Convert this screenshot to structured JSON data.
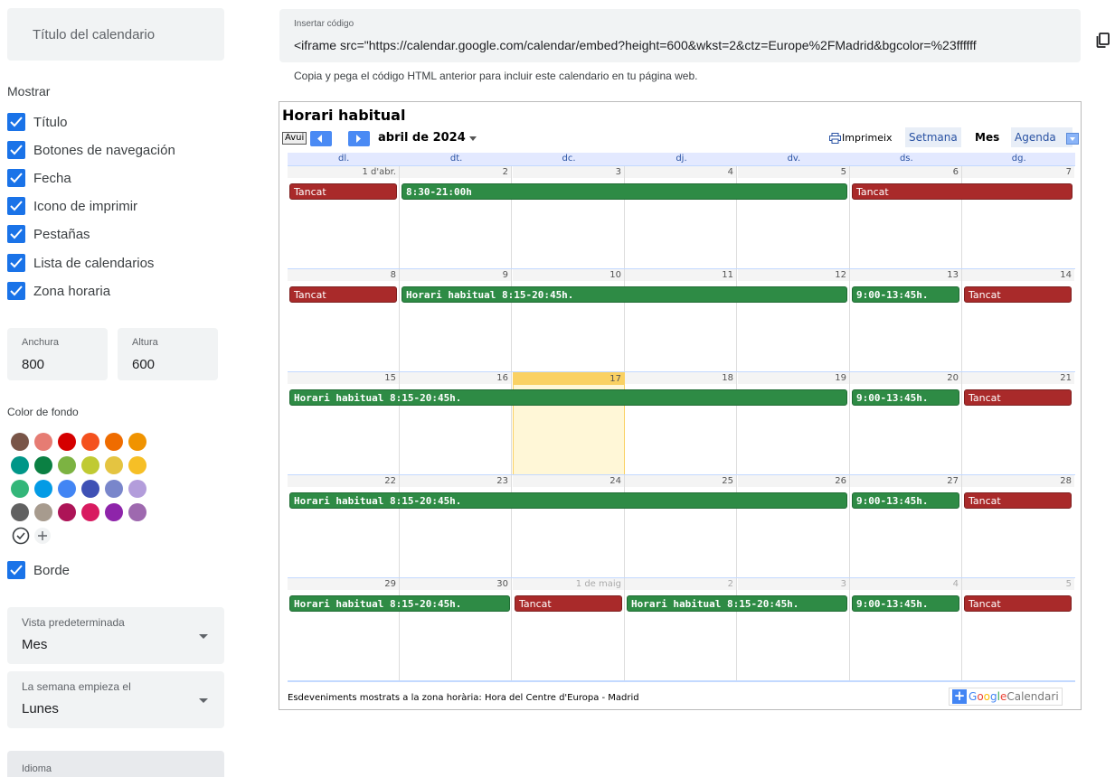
{
  "left": {
    "title_placeholder": "Título del calendario",
    "show_heading": "Mostrar",
    "checkboxes": [
      {
        "label": "Título",
        "checked": true
      },
      {
        "label": "Botones de navegación",
        "checked": true
      },
      {
        "label": "Fecha",
        "checked": true
      },
      {
        "label": "Icono de imprimir",
        "checked": true
      },
      {
        "label": "Pestañas",
        "checked": true
      },
      {
        "label": "Lista de calendarios",
        "checked": true
      },
      {
        "label": "Zona horaria",
        "checked": true
      }
    ],
    "width_label": "Anchura",
    "width_value": "800",
    "height_label": "Altura",
    "height_value": "600",
    "bg_color_heading": "Color de fondo",
    "swatch_colors": [
      [
        "#795548",
        "#e67c73",
        "#d50000",
        "#f4511e",
        "#ef6c00",
        "#f09300"
      ],
      [
        "#009688",
        "#0b8043",
        "#7cb342",
        "#c0ca33",
        "#e4c441",
        "#f6bf26"
      ],
      [
        "#33b679",
        "#039be5",
        "#4285f4",
        "#3f51b5",
        "#7986cb",
        "#b39ddb"
      ],
      [
        "#616161",
        "#a79b8e",
        "#ad1457",
        "#d81b60",
        "#8e24aa",
        "#9e69af"
      ]
    ],
    "border_label": "Borde",
    "border_checked": true,
    "default_view_label": "Vista predeterminada",
    "default_view_value": "Mes",
    "week_start_label": "La semana empieza el",
    "week_start_value": "Lunes",
    "language_label": "Idioma"
  },
  "embed": {
    "label": "Insertar código",
    "code": "<iframe src=\"https://calendar.google.com/calendar/embed?height=600&wkst=2&ctz=Europe%2FMadrid&bgcolor=%23ffffff",
    "help": "Copia y pega el código HTML anterior para incluir este calendario en tu página web."
  },
  "calendar": {
    "title": "Horari habitual",
    "today_label": "Avui",
    "month_label": "abril de 2024",
    "print_label": "Imprimeix",
    "tabs": [
      "Setmana",
      "Mes",
      "Agenda"
    ],
    "active_tab": "Mes",
    "dow": [
      "dl.",
      "dt.",
      "dc.",
      "dj.",
      "dv.",
      "ds.",
      "dg."
    ],
    "weeks": [
      {
        "days": [
          "1 d'abr.",
          "2",
          "3",
          "4",
          "5",
          "6",
          "7"
        ],
        "other": [],
        "today": -1,
        "events": [
          {
            "text": "Tancat",
            "start": 0,
            "span": 1,
            "color": "red"
          },
          {
            "text": "8:30-21:00h",
            "start": 1,
            "span": 4,
            "color": "green"
          },
          {
            "text": "Tancat",
            "start": 5,
            "span": 2,
            "color": "red"
          }
        ]
      },
      {
        "days": [
          "8",
          "9",
          "10",
          "11",
          "12",
          "13",
          "14"
        ],
        "other": [],
        "today": -1,
        "events": [
          {
            "text": "Tancat",
            "start": 0,
            "span": 1,
            "color": "red"
          },
          {
            "text": "Horari habitual 8:15-20:45h.",
            "start": 1,
            "span": 4,
            "color": "green"
          },
          {
            "text": "9:00-13:45h.",
            "start": 5,
            "span": 1,
            "color": "green"
          },
          {
            "text": "Tancat",
            "start": 6,
            "span": 1,
            "color": "red"
          }
        ]
      },
      {
        "days": [
          "15",
          "16",
          "17",
          "18",
          "19",
          "20",
          "21"
        ],
        "other": [],
        "today": 2,
        "events": [
          {
            "text": "Horari habitual 8:15-20:45h.",
            "start": 0,
            "span": 5,
            "color": "green"
          },
          {
            "text": "9:00-13:45h.",
            "start": 5,
            "span": 1,
            "color": "green"
          },
          {
            "text": "Tancat",
            "start": 6,
            "span": 1,
            "color": "red"
          }
        ]
      },
      {
        "days": [
          "22",
          "23",
          "24",
          "25",
          "26",
          "27",
          "28"
        ],
        "other": [],
        "today": -1,
        "events": [
          {
            "text": "Horari habitual 8:15-20:45h.",
            "start": 0,
            "span": 5,
            "color": "green"
          },
          {
            "text": "9:00-13:45h.",
            "start": 5,
            "span": 1,
            "color": "green"
          },
          {
            "text": "Tancat",
            "start": 6,
            "span": 1,
            "color": "red"
          }
        ]
      },
      {
        "days": [
          "29",
          "30",
          "1 de maig",
          "2",
          "3",
          "4",
          "5"
        ],
        "other": [
          2,
          3,
          4,
          5,
          6
        ],
        "today": -1,
        "events": [
          {
            "text": "Horari habitual 8:15-20:45h.",
            "start": 0,
            "span": 2,
            "color": "green"
          },
          {
            "text": "Tancat",
            "start": 2,
            "span": 1,
            "color": "red"
          },
          {
            "text": "Horari habitual 8:15-20:45h.",
            "start": 3,
            "span": 2,
            "color": "green"
          },
          {
            "text": "9:00-13:45h.",
            "start": 5,
            "span": 1,
            "color": "green"
          },
          {
            "text": "Tancat",
            "start": 6,
            "span": 1,
            "color": "red"
          }
        ]
      }
    ],
    "timezone_note": "Esdeveniments mostrats a la zona horària: Hora del Centre d'Europa - Madrid",
    "badge": {
      "g": "G",
      "o1": "o",
      "o2": "o",
      "gl": "g",
      "l": "l",
      "e": "e",
      "suffix": "Calendari"
    }
  }
}
